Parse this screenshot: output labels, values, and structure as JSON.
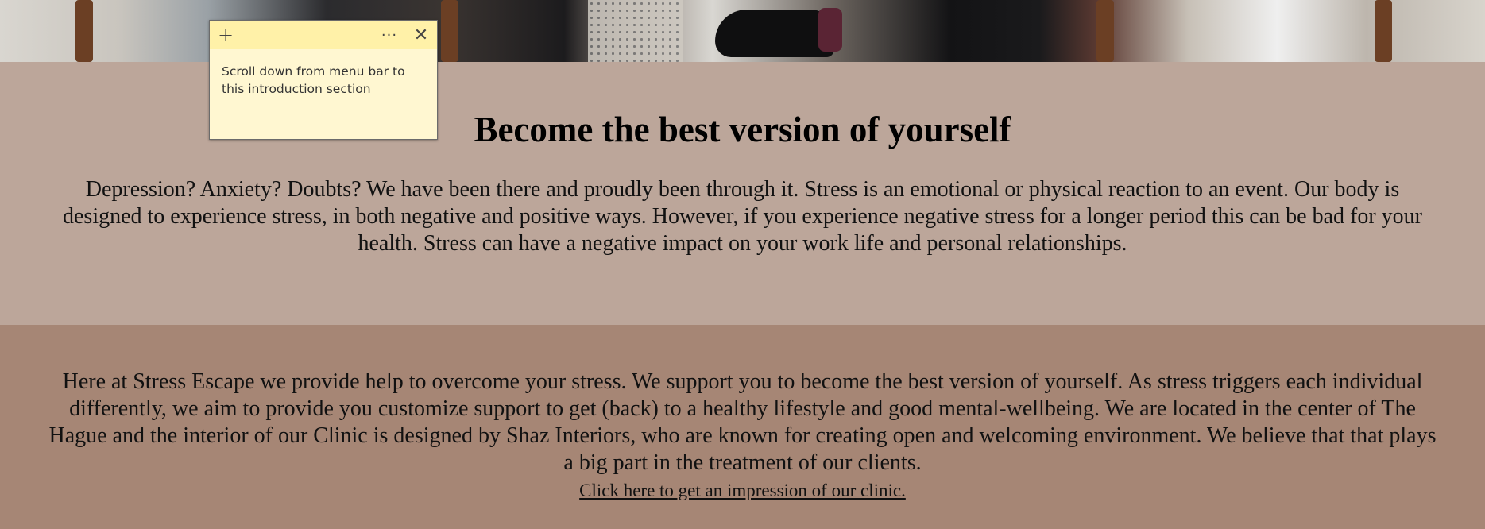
{
  "intro": {
    "title": "Become the best version of yourself",
    "body": "Depression? Anxiety? Doubts? We have been there and proudly been through it. Stress is an emotional or physical reaction to an event. Our body is designed to experience stress, in both negative and positive ways. However, if you experience negative stress for a longer period this can be bad for your health. Stress can have a negative impact on your work life and personal relationships."
  },
  "about": {
    "body": "Here at Stress Escape we provide help to overcome your stress. We support you to become the best version of yourself. As stress triggers each individual differently, we aim to provide you customize support to get (back) to a healthy lifestyle and good mental-wellbeing. We are located in the center of The Hague and the interior of our Clinic is designed by Shaz Interiors, who are known for creating open and welcoming environment. We believe that that plays a big part in the treatment of our clients.",
    "link_text": "Click here to get an impression of our clinic."
  },
  "sticky_note": {
    "add_icon": "+",
    "more_icon": "···",
    "close_icon": "✕",
    "text": "Scroll down from menu bar to\nthis introduction section"
  },
  "colors": {
    "intro_bg": "#bca69a",
    "about_bg": "#a68675",
    "sticky_title_bg": "#fff1a8",
    "sticky_body_bg": "#fff7d1"
  }
}
